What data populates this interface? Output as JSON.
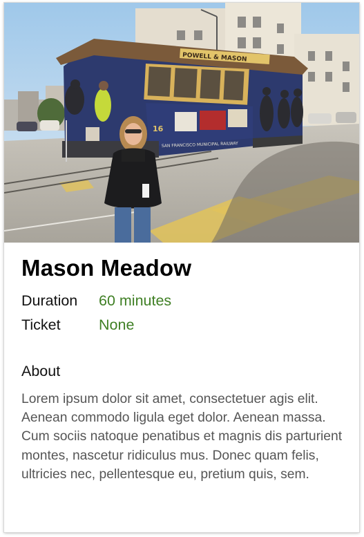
{
  "place": {
    "name": "Mason Meadow",
    "details": [
      {
        "label": "Duration",
        "value": "60 minutes"
      },
      {
        "label": "Ticket",
        "value": "None"
      }
    ],
    "about_heading": "About",
    "about_text": "Lorem ipsum dolor sit amet, consectetuer agis elit. Aenean commodo ligula eget dolor. Aenean massa. Cum sociis natoque penatibus et magnis dis parturient montes, nascetur ridiculus mus. Donec quam felis, ultricies nec, pellentesque eu, pretium quis, sem."
  },
  "photo": {
    "cable_car_sign": "POWELL & MASON",
    "car_number": "16",
    "car_side_text": "SAN FRANCISCO MUNICIPAL RAILWAY"
  },
  "colors": {
    "value_green": "#3f7f24",
    "body_gray": "#555555"
  }
}
